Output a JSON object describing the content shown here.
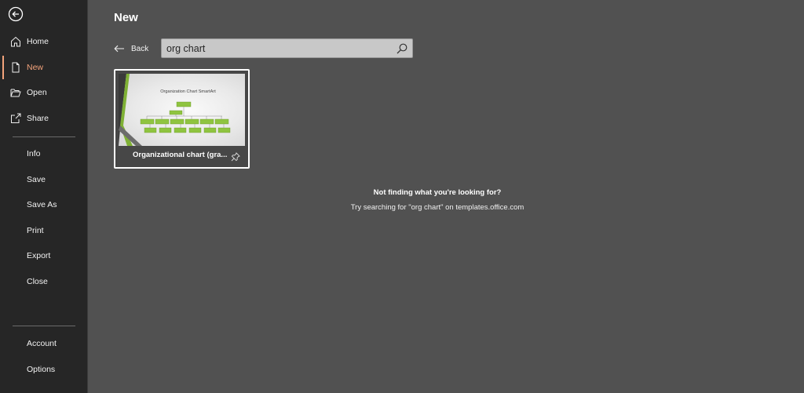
{
  "sidebar": {
    "items": [
      {
        "label": "Home",
        "icon": "home-icon"
      },
      {
        "label": "New",
        "icon": "new-document-icon",
        "active": true
      },
      {
        "label": "Open",
        "icon": "open-folder-icon"
      },
      {
        "label": "Share",
        "icon": "share-icon"
      },
      {
        "label": "Info"
      },
      {
        "label": "Save"
      },
      {
        "label": "Save As"
      },
      {
        "label": "Print"
      },
      {
        "label": "Export"
      },
      {
        "label": "Close"
      },
      {
        "label": "Account"
      },
      {
        "label": "Options"
      }
    ],
    "accent_color": "#f3a37b"
  },
  "header": {
    "title": "New"
  },
  "back": {
    "label": "Back"
  },
  "search": {
    "value": "org chart",
    "icon": "search-icon"
  },
  "results": [
    {
      "thumbnail_title": "Organization Chart SmartArt",
      "name": "Organizational chart (gra...",
      "pin_icon": "pin-icon"
    }
  ],
  "not_found": {
    "title": "Not finding what you're looking for?",
    "subtitle": "Try searching for \"org chart\" on templates.office.com"
  }
}
